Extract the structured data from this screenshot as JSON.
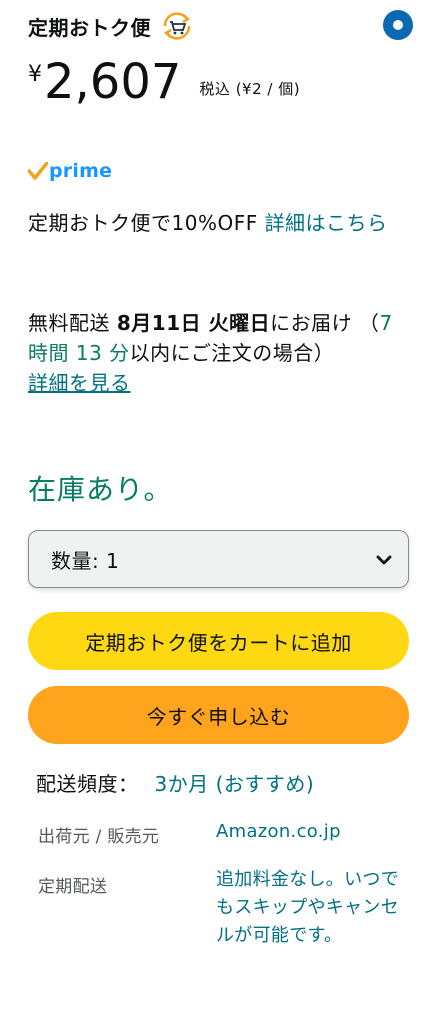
{
  "header": {
    "title": "定期おトク便",
    "cart_icon": "cart-refresh-icon",
    "radio_selected": true
  },
  "price": {
    "currency": "¥",
    "value": "2,607",
    "note": "税込 (¥2 / 個)"
  },
  "prime": {
    "label": "prime"
  },
  "discount": {
    "text": "定期おトク便で10%OFF ",
    "link": "詳細はこちら"
  },
  "delivery": {
    "prefix": "無料配送 ",
    "date": "8月11日 火曜日",
    "suffix": "にお届け （",
    "countdown": "7 時間 13 分",
    "tail": "以内にご注文の場合）",
    "details_link": "詳細を見る"
  },
  "stock": {
    "status": "在庫あり。"
  },
  "quantity": {
    "label": "数量: 1"
  },
  "buttons": {
    "add_to_cart": "定期おトク便をカートに追加",
    "subscribe_now": "今すぐ申し込む"
  },
  "frequency": {
    "label": "配送頻度：",
    "value": "3か月 (おすすめ)"
  },
  "shipping": {
    "seller_label": "出荷元 / 販売元",
    "seller_value": "Amazon.co.jp",
    "recurring_label": "定期配送",
    "recurring_value": "追加料金なし。いつでもスキップやキャンセルが可能です。"
  },
  "colors": {
    "accent_link": "#007185",
    "in_stock": "#067d62",
    "cart_button": "#ffd814",
    "buy_button": "#ffa41c",
    "prime_blue": "#1a98ff",
    "radio_blue": "#0a6ab1"
  }
}
